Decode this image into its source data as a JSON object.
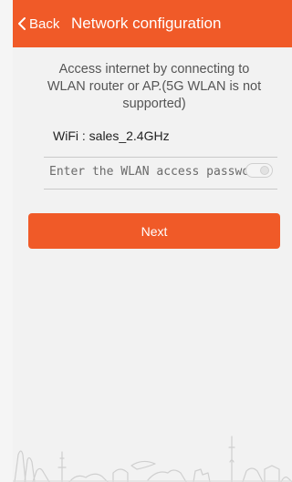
{
  "header": {
    "back_label": "Back",
    "title": "Network configuration",
    "color": "#f05a28"
  },
  "main": {
    "instructions": "Access internet by connecting to WLAN router or AP.(5G WLAN is not supported)",
    "wifi_label": "WiFi : sales_2.4GHz",
    "password": {
      "value": "",
      "placeholder": "Enter the WLAN access password"
    },
    "show_password_toggle": {
      "state": "off"
    },
    "next_label": "Next"
  },
  "footer": {
    "decoration": "city-skyline-illustration"
  }
}
